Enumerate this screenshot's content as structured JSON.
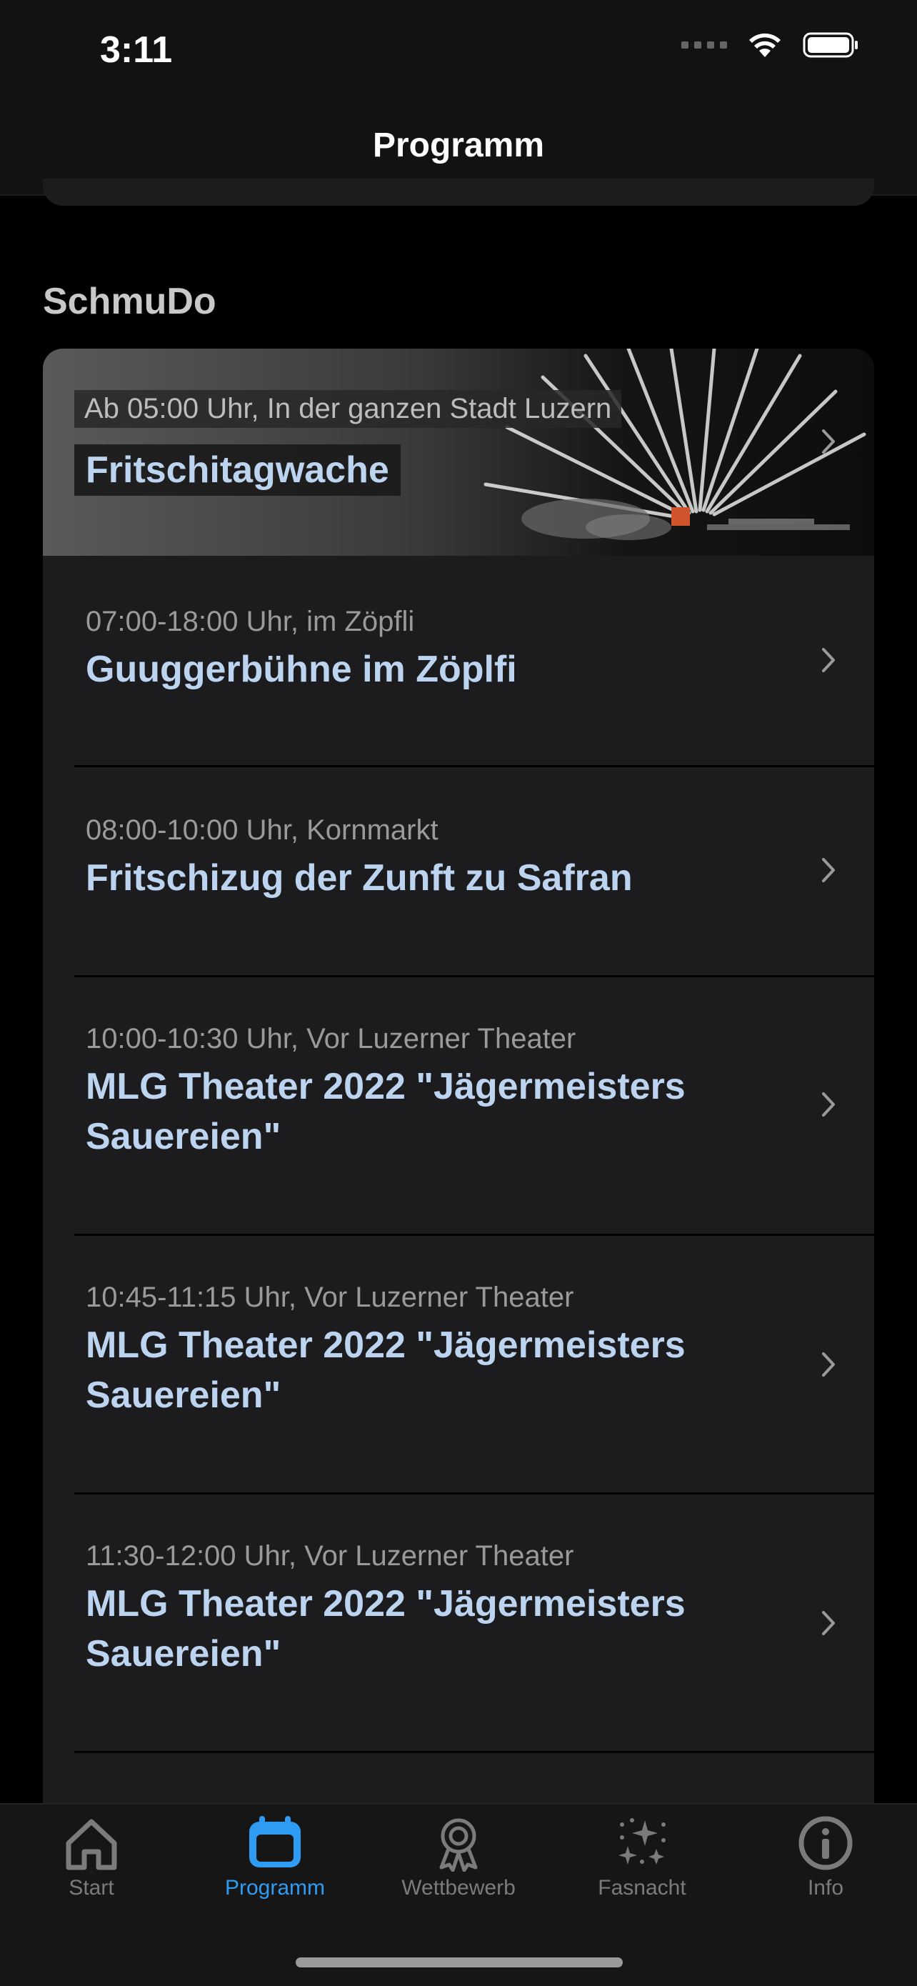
{
  "status_bar": {
    "time": "3:11"
  },
  "nav": {
    "title": "Programm"
  },
  "section": {
    "title": "SchmuDo"
  },
  "hero_event": {
    "subtitle": "Ab 05:00 Uhr, In der ganzen Stadt Luzern",
    "title": "Fritschitagwache"
  },
  "events": [
    {
      "subtitle": "07:00-18:00 Uhr, im Zöpfli",
      "title": "Guuggerbühne im Zöplfi"
    },
    {
      "subtitle": "08:00-10:00 Uhr, Kornmarkt",
      "title": "Fritschizug der Zunft zu Safran"
    },
    {
      "subtitle": "10:00-10:30 Uhr, Vor Luzerner Theater",
      "title": "MLG Theater 2022 \"Jägermeisters Sauereien\""
    },
    {
      "subtitle": "10:45-11:15 Uhr, Vor Luzerner Theater",
      "title": "MLG Theater 2022 \"Jägermeisters Sauereien\""
    },
    {
      "subtitle": "11:30-12:00 Uhr, Vor Luzerner Theater",
      "title": "MLG Theater 2022 \"Jägermeisters Sauereien\""
    }
  ],
  "tabs": [
    {
      "label": "Start",
      "icon": "home-icon"
    },
    {
      "label": "Programm",
      "icon": "calendar-icon",
      "active": true
    },
    {
      "label": "Wettbewerb",
      "icon": "award-icon"
    },
    {
      "label": "Fasnacht",
      "icon": "sparkles-icon"
    },
    {
      "label": "Info",
      "icon": "info-icon"
    }
  ],
  "colors": {
    "accent": "#2e9cf2",
    "event_title": "#bcd4f0",
    "background": "#000000",
    "card": "#1c1c1e"
  }
}
